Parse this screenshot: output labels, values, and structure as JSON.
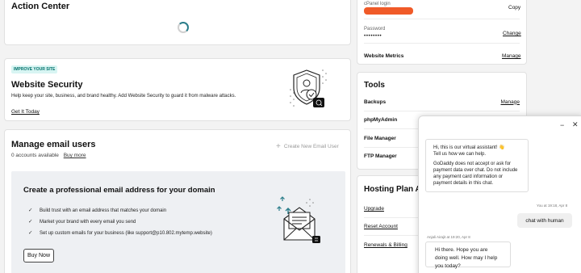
{
  "action_center": {
    "title": "Action Center"
  },
  "website_security": {
    "badge": "IMPROVE YOUR SITE",
    "title": "Website Security",
    "description": "Help keep your site, business, and brand healthy. Add Website Security to guard it from malware attacks.",
    "cta": "Get It Today"
  },
  "email": {
    "title": "Manage email users",
    "accounts": "0 accounts available",
    "buy_more": "Buy more",
    "create_new": "Create New Email User",
    "promo_title": "Create a professional email address for your domain",
    "bullets": [
      "Build trust with an email address that matches your domain",
      "Market your brand with every email you send",
      "Set up custom emails for your business (like support@p10.802.mytemp.website)"
    ],
    "buy_now": "Buy Now"
  },
  "account": {
    "cpanel_label": "cPanel login",
    "copy": "Copy",
    "password_label": "Password",
    "password_value": "••••••••",
    "change": "Change",
    "metrics_label": "Website Metrics",
    "manage": "Manage"
  },
  "tools": {
    "title": "Tools",
    "items": [
      {
        "label": "Backups",
        "action": "Manage"
      },
      {
        "label": "phpMyAdmin",
        "action": ""
      },
      {
        "label": "File Manager",
        "action": ""
      },
      {
        "label": "FTP Manager",
        "action": ""
      }
    ]
  },
  "hosting": {
    "title": "Hosting Plan Ac",
    "links": [
      "Upgrade",
      "Reset Account",
      "Renewals & Billing"
    ]
  },
  "chat": {
    "bot_message_1": "Hi, this is our virtual assistant! 👋",
    "bot_message_2": "Tell us how we can help.",
    "bot_message_3": "GoDaddy does not accept or ask for payment data over chat.  Do not include any payment card information or payment details in this chat.",
    "user_meta": "You at 19:18, Apr 8",
    "user_message": "chat with human",
    "agent_meta": "Anjali Airajit at 19:20, Apr 8",
    "agent_message": "Hi there. Hope you are doing well. How may I help you today?"
  },
  "colors": {
    "badge_bg": "#d8f5f3",
    "badge_text": "#00706a",
    "redaction": "#f05a28",
    "chat_bubble_user": "#efefef"
  }
}
